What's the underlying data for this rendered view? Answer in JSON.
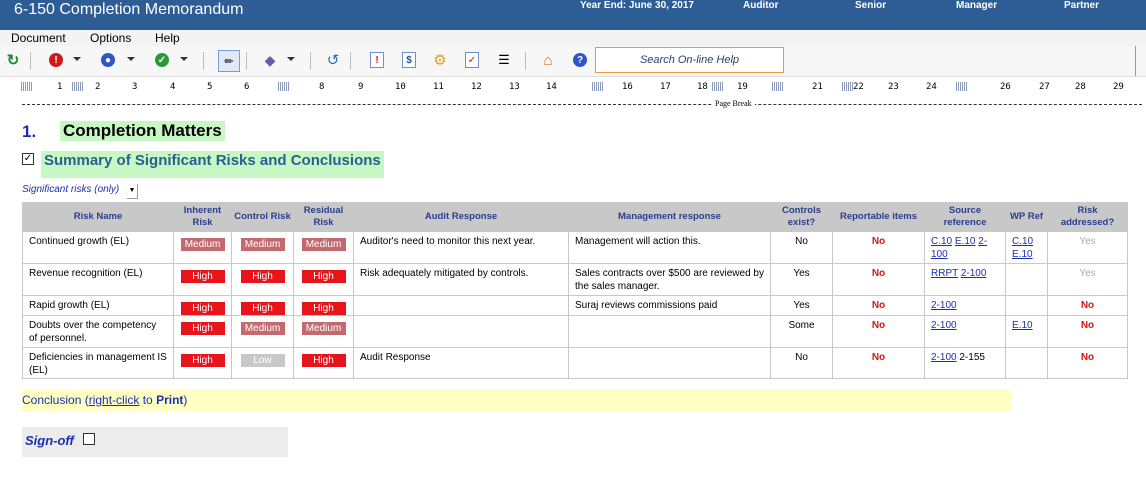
{
  "window": {
    "title": "6-150 Completion Memorandum",
    "year_end": "Year End: June 30, 2017",
    "roles": [
      "Auditor",
      "Senior",
      "Manager",
      "Partner"
    ]
  },
  "menu": [
    "Document",
    "Options",
    "Help"
  ],
  "toolbar": {
    "search_placeholder": "Search On-line Help",
    "icons": [
      "refresh-icon",
      "stop-icon",
      "info-icon",
      "check-icon",
      "ruler-icon",
      "bookmark-icon",
      "sync-icon",
      "alert-doc-icon",
      "dollar-doc-icon",
      "settings-icon",
      "checklist-icon",
      "add-list-icon",
      "home-icon",
      "help-icon"
    ]
  },
  "ruler": {
    "ticks": [
      "1",
      "2",
      "3",
      "4",
      "5",
      "6",
      "8",
      "9",
      "10",
      "11",
      "12",
      "13",
      "14",
      "16",
      "17",
      "18",
      "19",
      "21",
      "22",
      "23",
      "24",
      "26",
      "27",
      "28",
      "29"
    ],
    "page_break_label": "Page Break"
  },
  "section": {
    "number": "1.",
    "title": "Completion Matters",
    "subtitle": "Summary of Significant Risks and Conclusions",
    "filter_label": "Significant risks (only)"
  },
  "table": {
    "headers": [
      "Risk Name",
      "Inherent Risk",
      "Control Risk",
      "Residual Risk",
      "Audit Response",
      "Management response",
      "Controls exist?",
      "Reportable items",
      "Source reference",
      "WP Ref",
      "Risk addressed?"
    ],
    "rows": [
      {
        "name": "Continued growth (EL)",
        "inherent": "Medium",
        "control": "Medium",
        "residual": "Medium",
        "audit": "Auditor's need to monitor this next year.",
        "mgmt": "Management will action this.",
        "controls": "No",
        "reportable": "No",
        "source": [
          "C.10",
          "E.10",
          "2-100"
        ],
        "source_plain": "",
        "wp": [
          "C.10",
          "E.10"
        ],
        "addressed": "Yes"
      },
      {
        "name": "Revenue recognition (EL)",
        "inherent": "High",
        "control": "High",
        "residual": "High",
        "audit": "Risk adequately mitigated by controls.",
        "mgmt": "Sales contracts over $500 are reviewed by the sales manager.",
        "controls": "Yes",
        "reportable": "No",
        "source": [
          "RRPT",
          "2-100"
        ],
        "source_plain": "",
        "wp": [],
        "addressed": "Yes"
      },
      {
        "name": "Rapid growth (EL)",
        "inherent": "High",
        "control": "High",
        "residual": "High",
        "audit": "",
        "mgmt": "Suraj reviews commissions paid",
        "controls": "Yes",
        "reportable": "No",
        "source": [
          "2-100"
        ],
        "source_plain": "",
        "wp": [],
        "addressed": "No"
      },
      {
        "name": "Doubts over the competency of personnel.",
        "inherent": "High",
        "control": "Medium",
        "residual": "Medium",
        "audit": "",
        "mgmt": "",
        "controls": "Some",
        "reportable": "No",
        "source": [
          "2-100"
        ],
        "source_plain": "",
        "wp": [
          "E.10"
        ],
        "addressed": "No"
      },
      {
        "name": "Deficiencies in management IS (EL)",
        "inherent": "High",
        "control": "Low",
        "residual": "High",
        "audit": "Audit Response",
        "mgmt": "",
        "controls": "No",
        "reportable": "No",
        "source": [
          "2-100"
        ],
        "source_plain": "2-155",
        "wp": [],
        "addressed": "No"
      }
    ]
  },
  "conclusion": {
    "prefix": "Conclusion (",
    "link": "right-click",
    "middle": " to ",
    "bold": "Print",
    "suffix": ")"
  },
  "signoff": {
    "label": "Sign-off"
  },
  "colors": {
    "titlebar": "#2e5d95",
    "high": "#e8141c",
    "medium": "#c46a6e",
    "low": "#c8c8c8",
    "highlight": "#c7f7c3",
    "conclusion_bg": "#ffffc4"
  }
}
